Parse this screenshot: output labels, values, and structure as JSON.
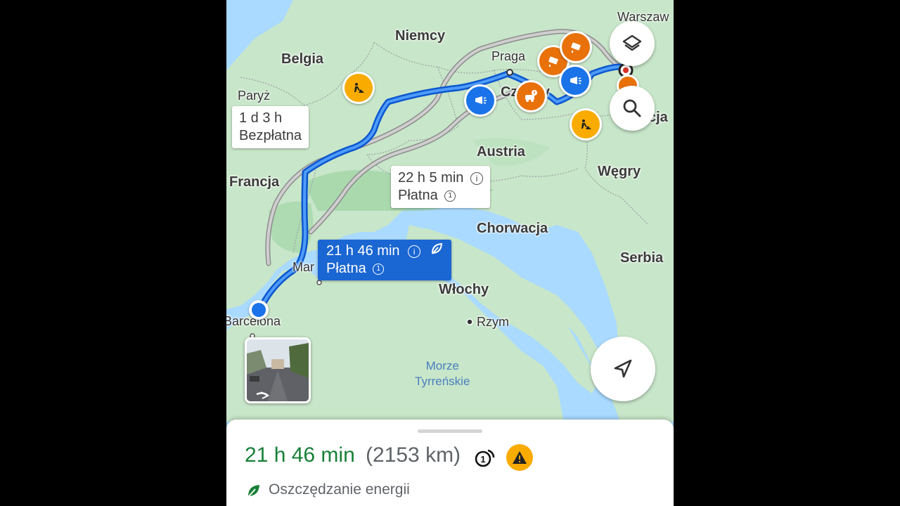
{
  "map": {
    "places": {
      "warszawa": "Warszaw",
      "niemcy": "Niemcy",
      "belgia": "Belgia",
      "paryz": "Paryż",
      "francja": "Francja",
      "praga": "Praga",
      "czechy": "Czechy",
      "austria": "Austria",
      "wegry": "Węgry",
      "chorwacja": "Chorwacja",
      "serbia": "Serbia",
      "wlochy": "Włochy",
      "rzym": "Rzym",
      "marsylia": "Mar",
      "barcelona": "Barcelona",
      "slowacja": "cja",
      "sea_line1": "Morze",
      "sea_line2": "Tyrreńskie"
    },
    "routes": [
      {
        "id": "route-free",
        "time": "1 d 3 h",
        "toll": "Bezpłatna",
        "selected": false
      },
      {
        "id": "route-alt",
        "time": "22 h 5 min",
        "toll": "Płatna",
        "selected": false
      },
      {
        "id": "route-main",
        "time": "21 h 46 min",
        "toll": "Płatna",
        "selected": true
      }
    ],
    "colors": {
      "route_selected": "#1a73e8",
      "route_alt": "#9e9e9e",
      "land": "#c8e6c9",
      "water": "#aadaff"
    }
  },
  "controls": {
    "layers": "layers-icon",
    "search": "search-icon",
    "navigate": "navigation-arrow-icon"
  },
  "sheet": {
    "duration": "21 h 46 min",
    "distance": "(2153 km)",
    "eco_label": "Oszczędzanie energii"
  }
}
